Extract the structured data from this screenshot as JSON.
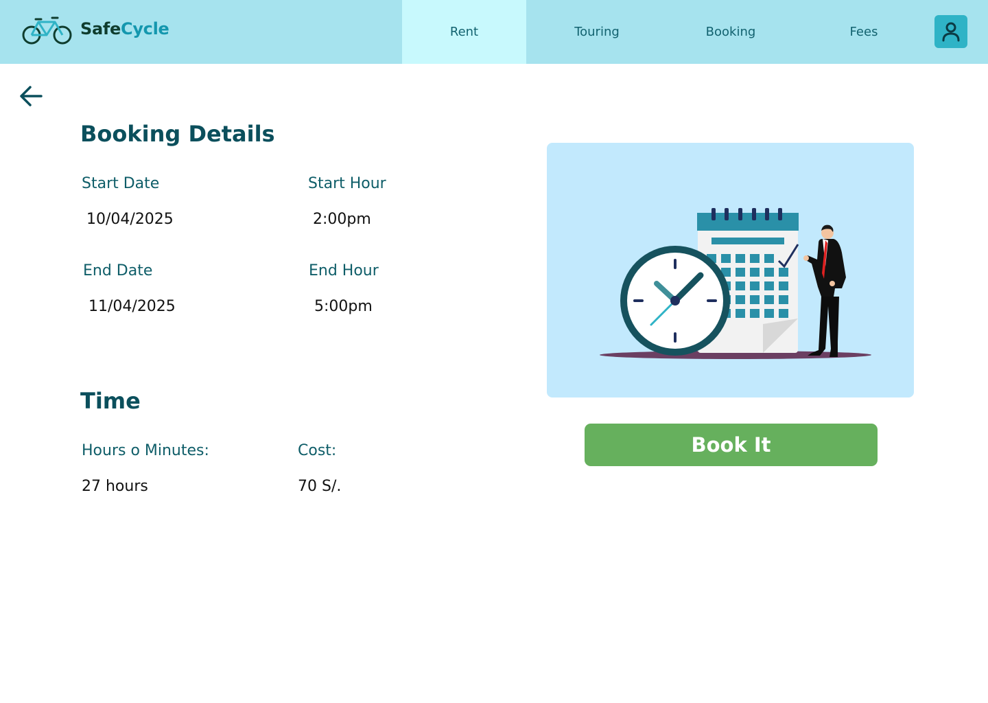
{
  "header": {
    "brand_part1": "Safe",
    "brand_part2": "Cycle",
    "tabs": [
      {
        "label": "Rent"
      },
      {
        "label": "Touring"
      },
      {
        "label": "Booking"
      },
      {
        "label": "Fees"
      }
    ],
    "active_tab": "Rent",
    "user_icon": "user-icon",
    "logo_icon": "bicycle-icon"
  },
  "back_icon": "arrow-left-icon",
  "booking": {
    "title": "Booking Details",
    "start_date_label": "Start Date",
    "start_date": "10/04/2025",
    "start_hour_label": "Start Hour",
    "start_hour": "2:00pm",
    "end_date_label": "End Date",
    "end_date": "11/04/2025",
    "end_hour_label": "End Hour",
    "end_hour": "5:00pm"
  },
  "time": {
    "title": "Time",
    "duration_label": "Hours o Minutes:",
    "duration": "27 hours",
    "cost_label": "Cost:",
    "cost": "70 S/."
  },
  "illustration_icon": "calendar-clock-illustration",
  "book_button": "Book It",
  "colors": {
    "header_bg": "#a6e3ee",
    "active_tab_bg": "#c8f9fd",
    "primary_text": "#0b4f5c",
    "accent": "#2fb3c6",
    "button_green": "#66b05d",
    "illustration_bg": "#c2e9fd"
  }
}
